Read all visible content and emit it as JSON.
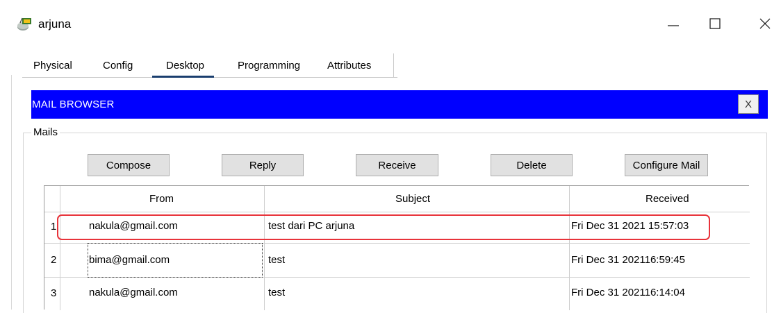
{
  "window": {
    "title": "arjuna",
    "icon": "router-device-icon",
    "controls": {
      "minimize": "—",
      "maximize": "☐",
      "close": "✕"
    }
  },
  "tabs": [
    {
      "label": "Physical",
      "selected": false
    },
    {
      "label": "Config",
      "selected": false
    },
    {
      "label": "Desktop",
      "selected": true
    },
    {
      "label": "Programming",
      "selected": false
    },
    {
      "label": "Attributes",
      "selected": false
    }
  ],
  "mail_browser": {
    "title": "MAIL BROWSER",
    "close_label": "X",
    "title_bar_color": "#0000ff",
    "group_label": "Mails",
    "buttons": {
      "compose": "Compose",
      "reply": "Reply",
      "receive": "Receive",
      "delete": "Delete",
      "configure": "Configure Mail"
    },
    "table": {
      "columns": [
        "From",
        "Subject",
        "Received"
      ],
      "rows": [
        {
          "index": "1",
          "from": "nakula@gmail.com",
          "subject": "test dari PC arjuna",
          "received": "Fri Dec 31 2021 15:57:03"
        },
        {
          "index": "2",
          "from": "bima@gmail.com",
          "subject": "test",
          "received": "Fri Dec 31 202116:59:45"
        },
        {
          "index": "3",
          "from": "nakula@gmail.com",
          "subject": "test",
          "received": "Fri Dec 31 202116:14:04"
        }
      ]
    }
  },
  "annotation": {
    "highlight_color": "#e8333a",
    "highlighted_row": 1
  }
}
